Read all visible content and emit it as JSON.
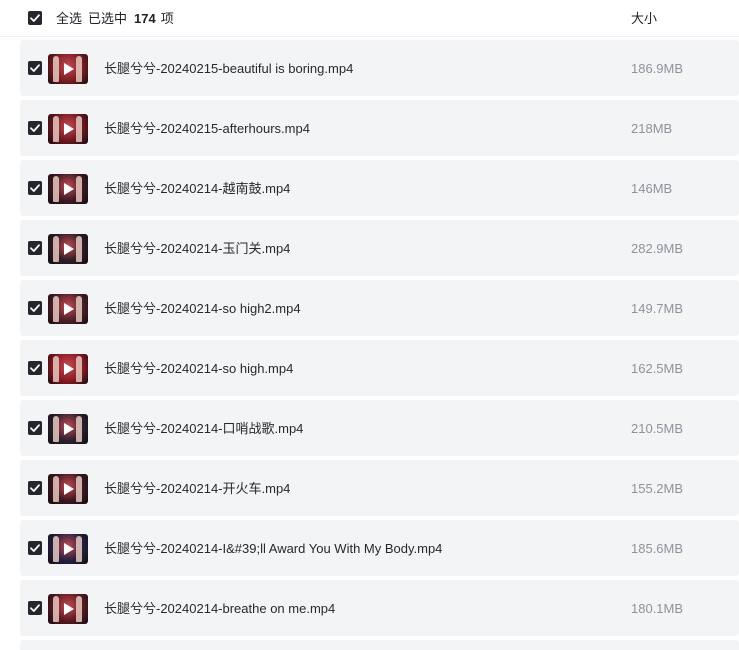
{
  "header": {
    "select_all_label": "全选",
    "selected_prefix": "已选中",
    "selected_count": "174",
    "selected_suffix": "项",
    "size_column_label": "大小"
  },
  "files": [
    {
      "name": "长腿兮兮-20240215-beautiful is boring.mp4",
      "size": "186.9MB",
      "checked": true,
      "thumb_color": "#7a1d22"
    },
    {
      "name": "长腿兮兮-20240215-afterhours.mp4",
      "size": "218MB",
      "checked": true,
      "thumb_color": "#6e1820"
    },
    {
      "name": "长腿兮兮-20240214-越南鼓.mp4",
      "size": "146MB",
      "checked": true,
      "thumb_color": "#3a1a22"
    },
    {
      "name": "长腿兮兮-20240214-玉门关.mp4",
      "size": "282.9MB",
      "checked": true,
      "thumb_color": "#2e1c26"
    },
    {
      "name": "长腿兮兮-20240214-so high2.mp4",
      "size": "149.7MB",
      "checked": true,
      "thumb_color": "#4a1f28"
    },
    {
      "name": "长腿兮兮-20240214-so high.mp4",
      "size": "162.5MB",
      "checked": true,
      "thumb_color": "#8a1a22"
    },
    {
      "name": "长腿兮兮-20240214-口哨战歌.mp4",
      "size": "210.5MB",
      "checked": true,
      "thumb_color": "#2a2030"
    },
    {
      "name": "长腿兮兮-20240214-开火车.mp4",
      "size": "155.2MB",
      "checked": true,
      "thumb_color": "#3b1820"
    },
    {
      "name": "长腿兮兮-20240214-I&#39;ll Award You With My Body.mp4",
      "size": "185.6MB",
      "checked": true,
      "thumb_color": "#232040"
    },
    {
      "name": "长腿兮兮-20240214-breathe on me.mp4",
      "size": "180.1MB",
      "checked": true,
      "thumb_color": "#5a1a22"
    }
  ],
  "icons": {
    "checkbox": "checkbox-checked-icon",
    "play": "play-icon"
  },
  "colors": {
    "checkbox_fill": "#24272d",
    "row_background": "#f3f4f6",
    "size_text": "#8d939c"
  }
}
